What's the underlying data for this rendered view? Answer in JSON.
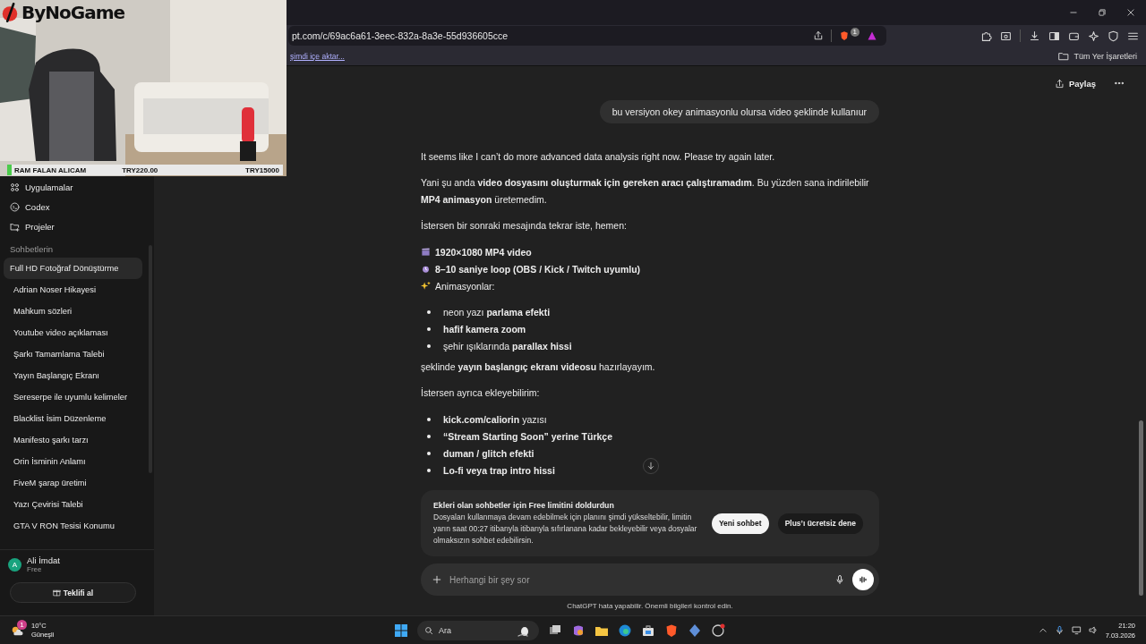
{
  "browser": {
    "url": "pt.com/c/69ac6a61-3eec-832a-8a3e-55d936605cce",
    "shield_badge": "1",
    "bookmark_link": "şimdi içe aktar...",
    "bookmarks_folder": "Tüm Yer İşaretleri"
  },
  "stream_overlay": {
    "logo": "ByNoGame",
    "goal": {
      "label": "RAM FALAN ALICAM",
      "raised": "TRY220.00",
      "target": "TRY15000",
      "level": 0.015
    }
  },
  "sidebar": {
    "nav": [
      "Uygulamalar",
      "Codex",
      "Projeler"
    ],
    "section": "Sohbetlerin",
    "chats": [
      {
        "title": "Full HD Fotoğraf Dönüştürme",
        "selected": true
      },
      {
        "title": "Adrian Noser Hikayesi",
        "selected": false
      },
      {
        "title": "Mahkum sözleri",
        "selected": false
      },
      {
        "title": "Youtube video açıklaması",
        "selected": false
      },
      {
        "title": "Şarkı Tamamlama Talebi",
        "selected": false
      },
      {
        "title": "Yayın Başlangıç Ekranı",
        "selected": false
      },
      {
        "title": "Sereserpe ile uyumlu kelimeler",
        "selected": false
      },
      {
        "title": "Blacklist İsim Düzenleme",
        "selected": false
      },
      {
        "title": "Manifesto şarkı tarzı",
        "selected": false
      },
      {
        "title": "Orin İsminin Anlamı",
        "selected": false
      },
      {
        "title": "FiveM şarap üretimi",
        "selected": false
      },
      {
        "title": "Yazı Çevirisi Talebi",
        "selected": false
      },
      {
        "title": "GTA V RON Tesisi Konumu",
        "selected": false
      }
    ],
    "user": {
      "initial": "A",
      "name": "Ali İmdat",
      "plan": "Free"
    },
    "offer_button": "Teklifi al"
  },
  "chat": {
    "share": "Paylaş",
    "user_message": "bu versiyon okey animasyonlu olursa video şeklinde kullanıur",
    "blocks": [
      {
        "kind": "paragraph",
        "text": "It seems like I can’t do more advanced data analysis right now. Please try again later."
      },
      {
        "kind": "paragraph",
        "text": "Yani şu anda **video dosyasını oluşturmak için gereken aracı çalıştıramadım**. Bu yüzden sana indirilebilir **MP4 animasyon** üretemedim."
      },
      {
        "kind": "paragraph",
        "text": "İstersen bir sonraki mesajında tekrar iste, hemen:"
      },
      {
        "kind": "icon_lines",
        "lines": [
          "**1920×1080 MP4 video**",
          "**8–10 saniye loop (OBS / Kick / Twitch uyumlu)**",
          "Animasyonlar:"
        ]
      },
      {
        "kind": "bullets",
        "items": [
          "neon yazı **parlama efekti**",
          "**hafif kamera zoom**",
          "şehir ışıklarında **parallax hissi**"
        ]
      },
      {
        "kind": "paragraph",
        "text": "şeklinde **yayın başlangıç ekranı videosu** hazırlayayım."
      },
      {
        "kind": "paragraph",
        "text": "İstersen ayrıca ekleyebilirim:"
      },
      {
        "kind": "bullets",
        "items": [
          "**kick.com/caliorin** yazısı",
          "**“Stream Starting Soon” yerine Türkçe**",
          "**duman / glitch efekti**",
          "**Lo-fi veya trap intro hissi**"
        ]
      }
    ]
  },
  "notice": {
    "title": "Ekleri olan sohbetler için Free limitini doldurdun",
    "body": "Dosyaları kullanmaya devam edebilmek için planını şimdi yükseltebilir, limitin yarın saat 00:27 itibarıyla itibarıyla sıfırlanana kadar bekleyebilir veya dosyalar olmaksızın sohbet edebilirsin.",
    "buttons": [
      {
        "label": "Yeni sohbet",
        "primary": true
      },
      {
        "label": "Plus’ı ücretsiz dene",
        "primary": false
      }
    ]
  },
  "composer": {
    "placeholder": "Herhangi bir şey sor"
  },
  "disclaimer": "ChatGPT hata yapabilir. Önemli bilgileri kontrol edin.",
  "taskbar": {
    "temperature": "10°C",
    "weather": "Güneşli",
    "weather_badge": "1",
    "search": "Ara",
    "time": "21:20",
    "date": "7.03.2026"
  }
}
